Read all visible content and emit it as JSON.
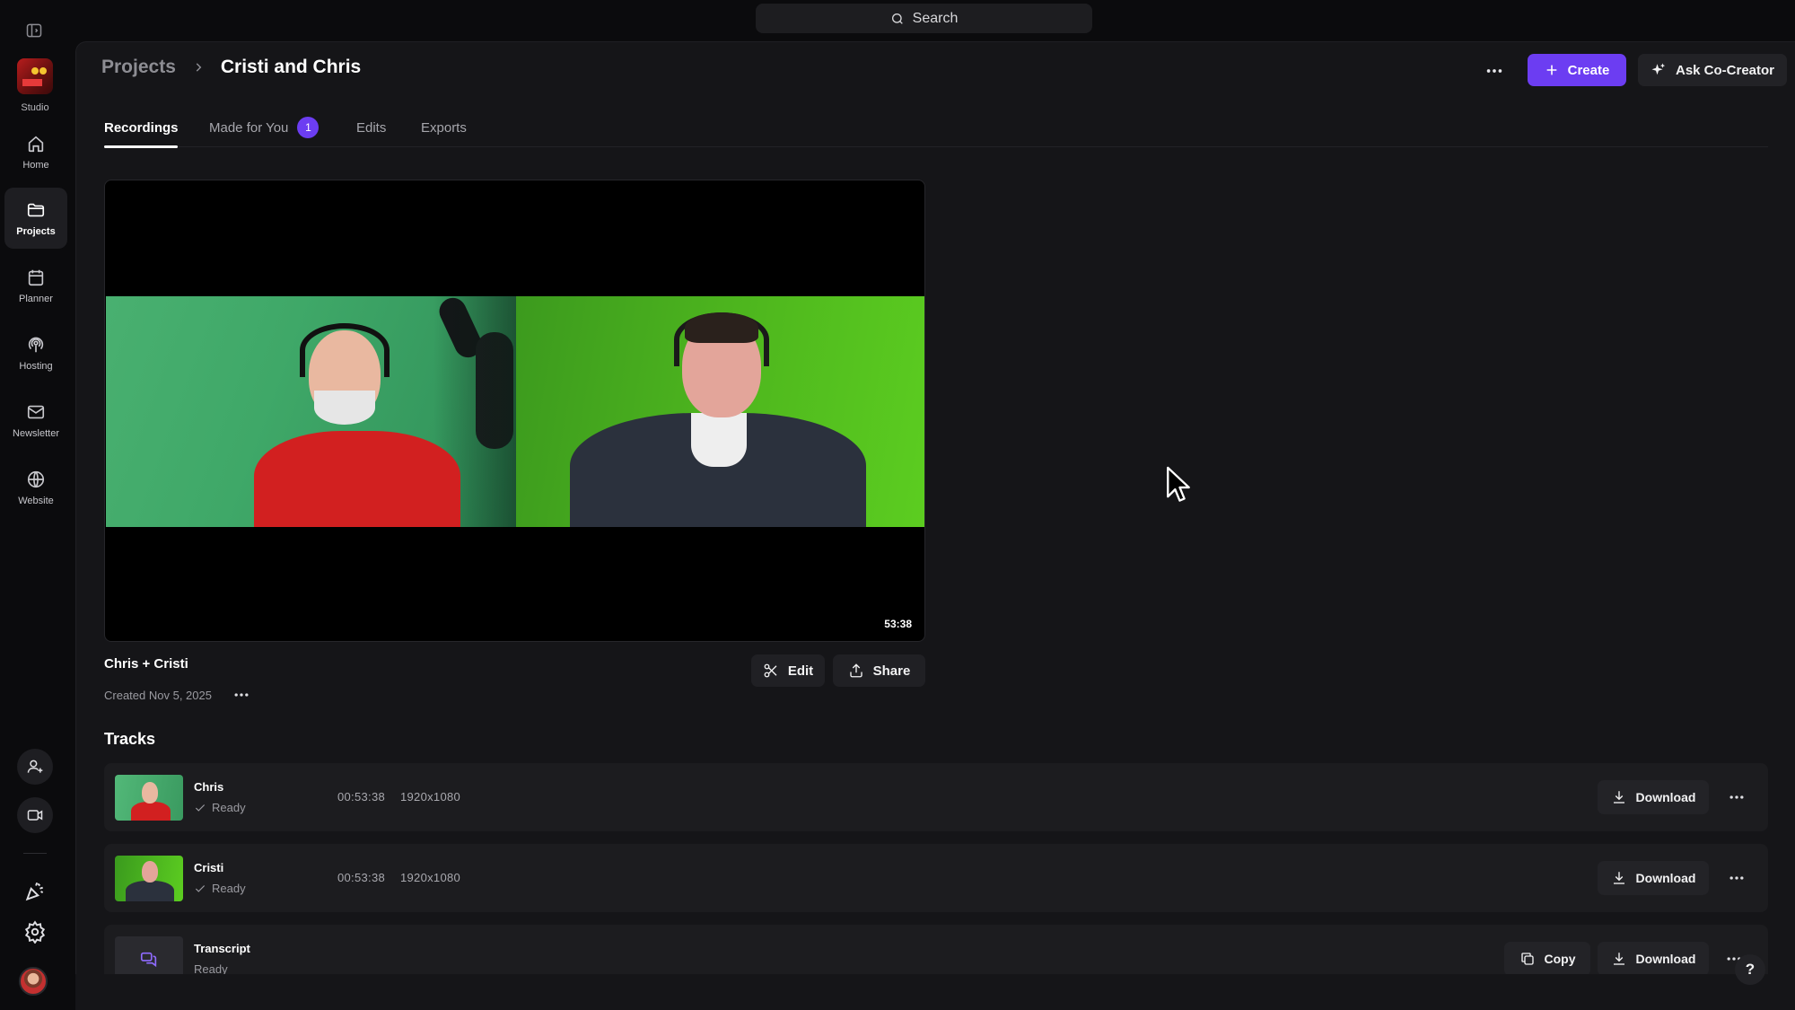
{
  "search": {
    "label": "Search"
  },
  "sidebar": {
    "studio_label": "Studio",
    "items": [
      {
        "label": "Home",
        "icon": "home-icon"
      },
      {
        "label": "Projects",
        "icon": "folder-icon",
        "active": true
      },
      {
        "label": "Planner",
        "icon": "calendar-icon"
      },
      {
        "label": "Hosting",
        "icon": "podcast-icon"
      },
      {
        "label": "Newsletter",
        "icon": "mail-icon"
      },
      {
        "label": "Website",
        "icon": "globe-icon"
      }
    ]
  },
  "header": {
    "breadcrumb_parent": "Projects",
    "breadcrumb_current": "Cristi and Chris",
    "create_label": "Create",
    "cocreator_label": "Ask Co-Creator"
  },
  "tabs": [
    {
      "label": "Recordings",
      "active": true
    },
    {
      "label": "Made for You",
      "badge": "1"
    },
    {
      "label": "Edits"
    },
    {
      "label": "Exports"
    }
  ],
  "recording": {
    "duration": "53:38",
    "title": "Chris + Cristi",
    "created": "Created Nov 5, 2025",
    "edit_label": "Edit",
    "share_label": "Share"
  },
  "tracks": {
    "heading": "Tracks",
    "rows": [
      {
        "name": "Chris",
        "status": "Ready",
        "duration": "00:53:38",
        "resolution": "1920x1080",
        "download_label": "Download"
      },
      {
        "name": "Cristi",
        "status": "Ready",
        "duration": "00:53:38",
        "resolution": "1920x1080",
        "download_label": "Download"
      },
      {
        "name": "Transcript",
        "status": "Ready",
        "copy_label": "Copy",
        "download_label": "Download"
      }
    ]
  },
  "help_label": "?",
  "colors": {
    "accent": "#6c3df2",
    "background": "#0b0b0d",
    "panel": "#151518",
    "row": "#1c1c1f"
  }
}
